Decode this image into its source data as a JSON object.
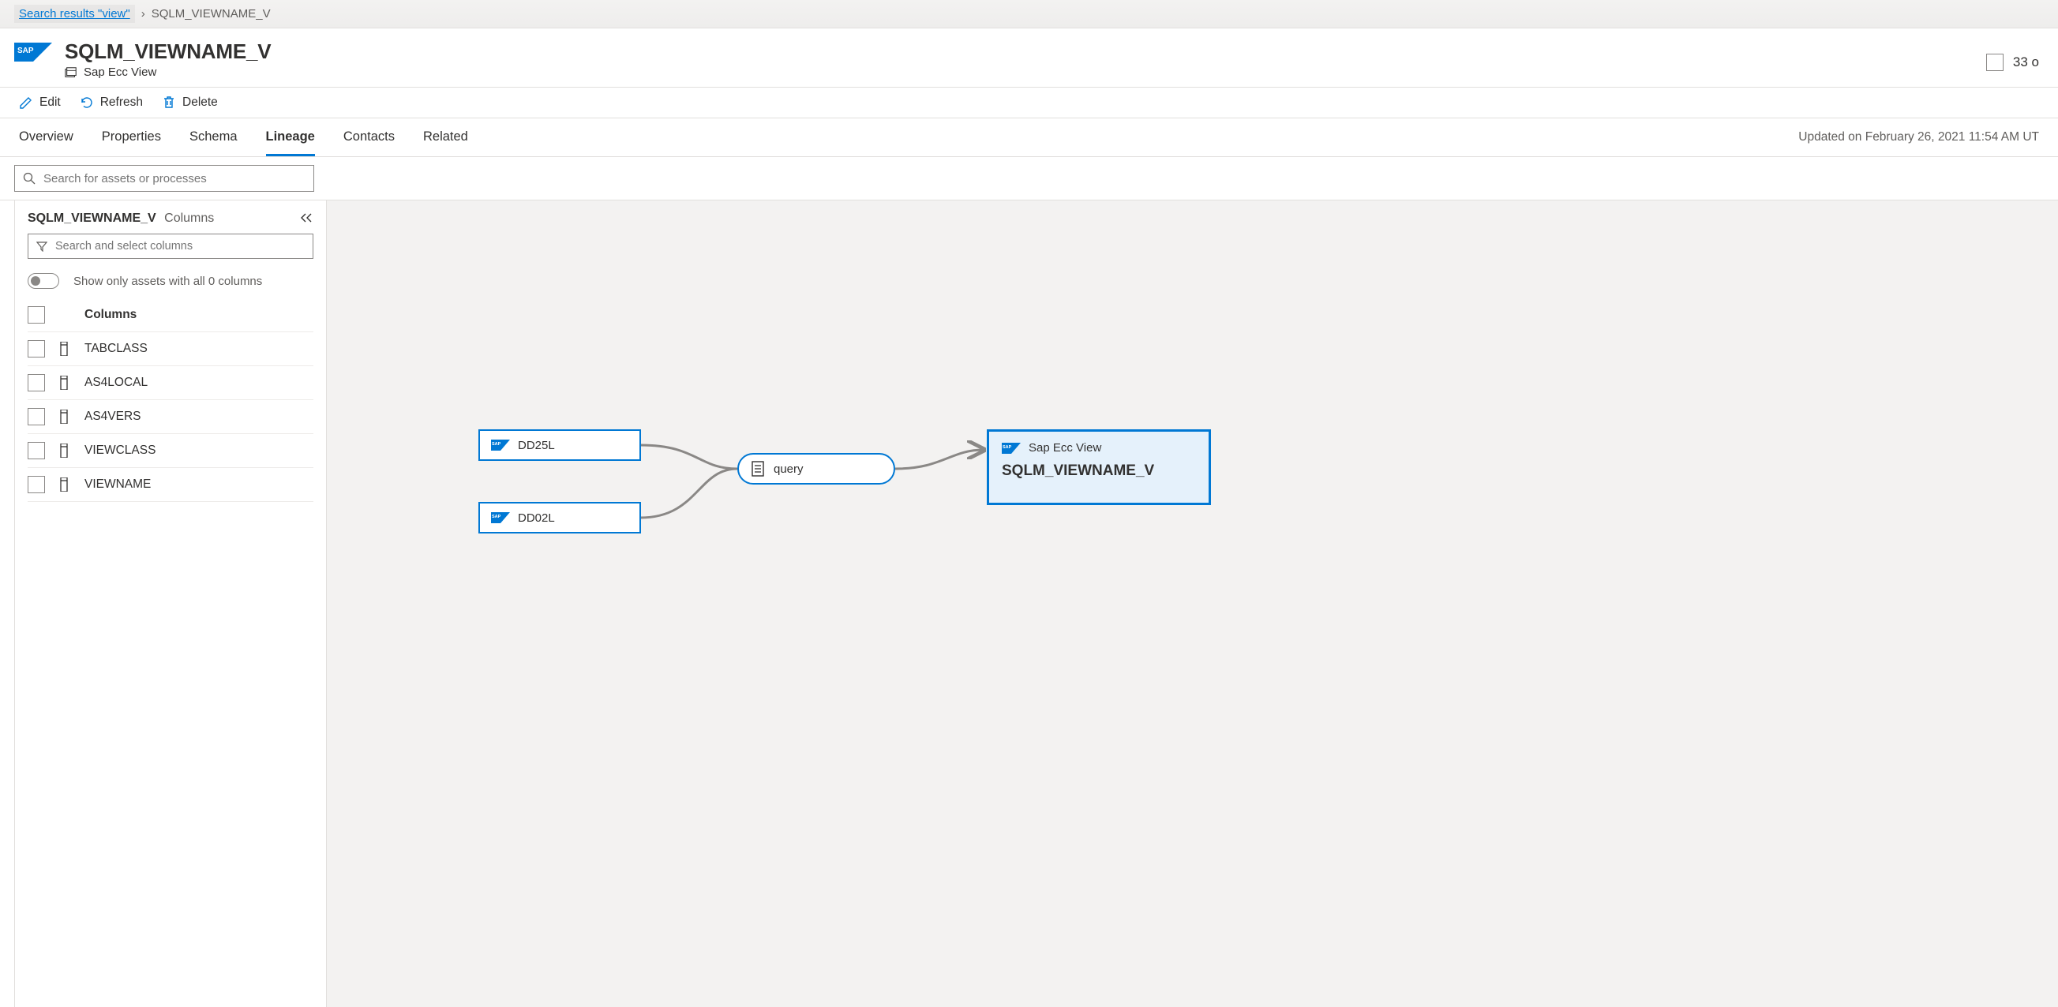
{
  "breadcrumb": {
    "link_text": "Search results \"view\"",
    "current": "SQLM_VIEWNAME_V"
  },
  "header": {
    "title": "SQLM_VIEWNAME_V",
    "subtitle": "Sap Ecc View",
    "count_fragment": "33 o"
  },
  "toolbar": {
    "edit": "Edit",
    "refresh": "Refresh",
    "delete": "Delete"
  },
  "tabs": {
    "items": [
      {
        "label": "Overview"
      },
      {
        "label": "Properties"
      },
      {
        "label": "Schema"
      },
      {
        "label": "Lineage"
      },
      {
        "label": "Contacts"
      },
      {
        "label": "Related"
      }
    ],
    "active_index": 3,
    "updated_text": "Updated on February 26, 2021 11:54 AM UT"
  },
  "lineage_search": {
    "placeholder": "Search for assets or processes"
  },
  "panel": {
    "title": "SQLM_VIEWNAME_V",
    "columns_label": "Columns",
    "col_filter_placeholder": "Search and select columns",
    "toggle_label": "Show only assets with all 0 columns",
    "columns_header": "Columns",
    "columns": [
      {
        "name": "TABCLASS"
      },
      {
        "name": "AS4LOCAL"
      },
      {
        "name": "AS4VERS"
      },
      {
        "name": "VIEWCLASS"
      },
      {
        "name": "VIEWNAME"
      }
    ]
  },
  "canvas": {
    "nodes": {
      "src1": {
        "label": "DD25L"
      },
      "src2": {
        "label": "DD02L"
      },
      "proc": {
        "label": "query"
      },
      "target_type": "Sap Ecc View",
      "target_name": "SQLM_VIEWNAME_V"
    }
  }
}
